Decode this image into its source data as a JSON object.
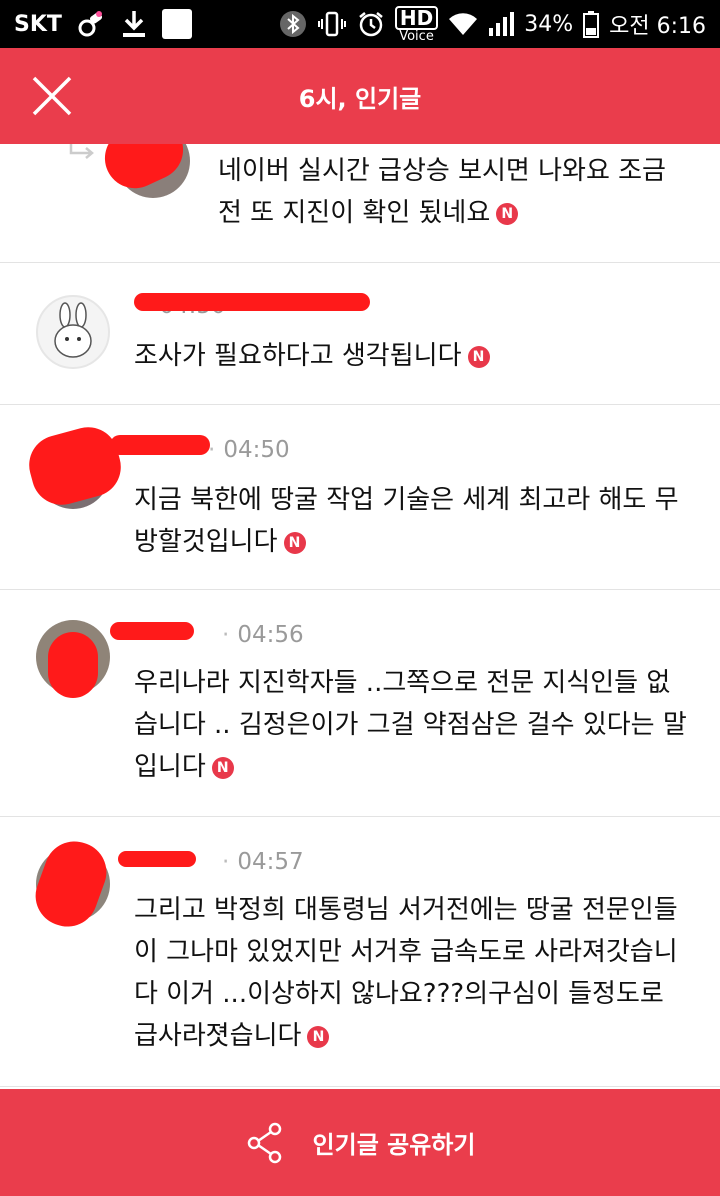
{
  "status_bar": {
    "carrier": "SKT",
    "battery": "34%",
    "time": "오전 6:16",
    "hd_label": "HD",
    "voice_label": "Voice",
    "icons": [
      "pacifier-icon",
      "download-icon",
      "square-notification-icon",
      "bluetooth-icon",
      "vibrate-icon",
      "alarm-icon",
      "wifi-icon",
      "signal-icon",
      "battery-icon"
    ]
  },
  "header": {
    "title": "6시, 인기글",
    "close_icon": "close-icon",
    "background": "#ea3d4c"
  },
  "comments": [
    {
      "text": "네이버 실시간 급상승 보시면 나와요 조금전 또 지진이 확인 됬네요",
      "badge": "N",
      "avatar_icon": "user-avatar"
    },
    {
      "name": "",
      "time": "04:50",
      "text": "조사가 필요하다고 생각됩니다",
      "badge": "N",
      "avatar_icon": "rabbit-avatar"
    },
    {
      "name": "",
      "time": "04:50",
      "text": "지금 북한에 땅굴 작업 기술은 세계 최고라 해도 무방할것입니다",
      "badge": "N",
      "avatar_icon": "user-avatar"
    },
    {
      "name": "",
      "time": "04:56",
      "text": "우리나라 지진학자들 ..그쪽으로 전문 지식인들 없습니다 .. 김정은이가 그걸 약점삼은 걸수 있다는 말입니다",
      "badge": "N",
      "avatar_icon": "user-avatar"
    },
    {
      "name": "",
      "time": "04:57",
      "text": "그리고 박정희 대통령님 서거전에는 땅굴 전문인들이 그나마 있었지만 서거후 급속도로 사라져갓습니다 이거 ...이상하지 않나요???의구심이 들정도로 급사라졋습니다",
      "badge": "N",
      "avatar_icon": "user-avatar"
    }
  ],
  "footer": {
    "label": "인기글 공유하기",
    "icon": "share-icon"
  }
}
